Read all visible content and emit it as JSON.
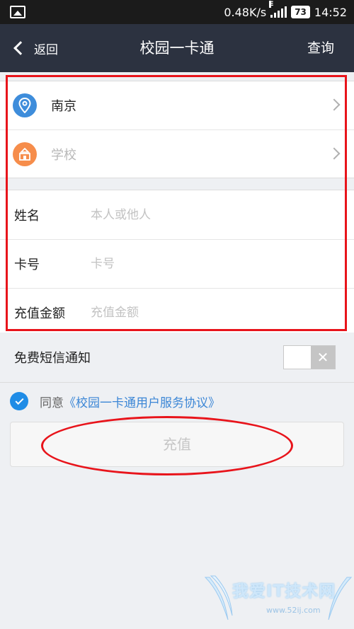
{
  "status_bar": {
    "speed": "0.48K/s",
    "battery": "73",
    "time": "14:52",
    "network": "E"
  },
  "header": {
    "back_label": "返回",
    "title": "校园一卡通",
    "query_label": "查询"
  },
  "location": [
    {
      "label": "南京",
      "icon": "map-pin-icon",
      "state": "selected"
    },
    {
      "label": "学校",
      "icon": "school-icon",
      "state": "unselected"
    }
  ],
  "fields": [
    {
      "label": "姓名",
      "placeholder": "本人或他人",
      "value": ""
    },
    {
      "label": "卡号",
      "placeholder": "卡号",
      "value": ""
    },
    {
      "label": "充值金额",
      "placeholder": "充值金额",
      "value": ""
    }
  ],
  "sms": {
    "label": "免费短信通知",
    "toggle_symbol": "✕",
    "enabled": false
  },
  "agreement": {
    "prefix": "同意",
    "link": "《校园一卡通用户服务协议》",
    "checked": true
  },
  "recharge_button": {
    "label": "充值"
  },
  "watermark": {
    "text": "我爱IT技术网",
    "url": "www.52ij.com"
  },
  "colors": {
    "header_bg": "#2c3240",
    "accent": "#1f8ce6",
    "annotation": "#e8141b",
    "pin": "#3e8ddb",
    "school": "#f57a2c"
  }
}
